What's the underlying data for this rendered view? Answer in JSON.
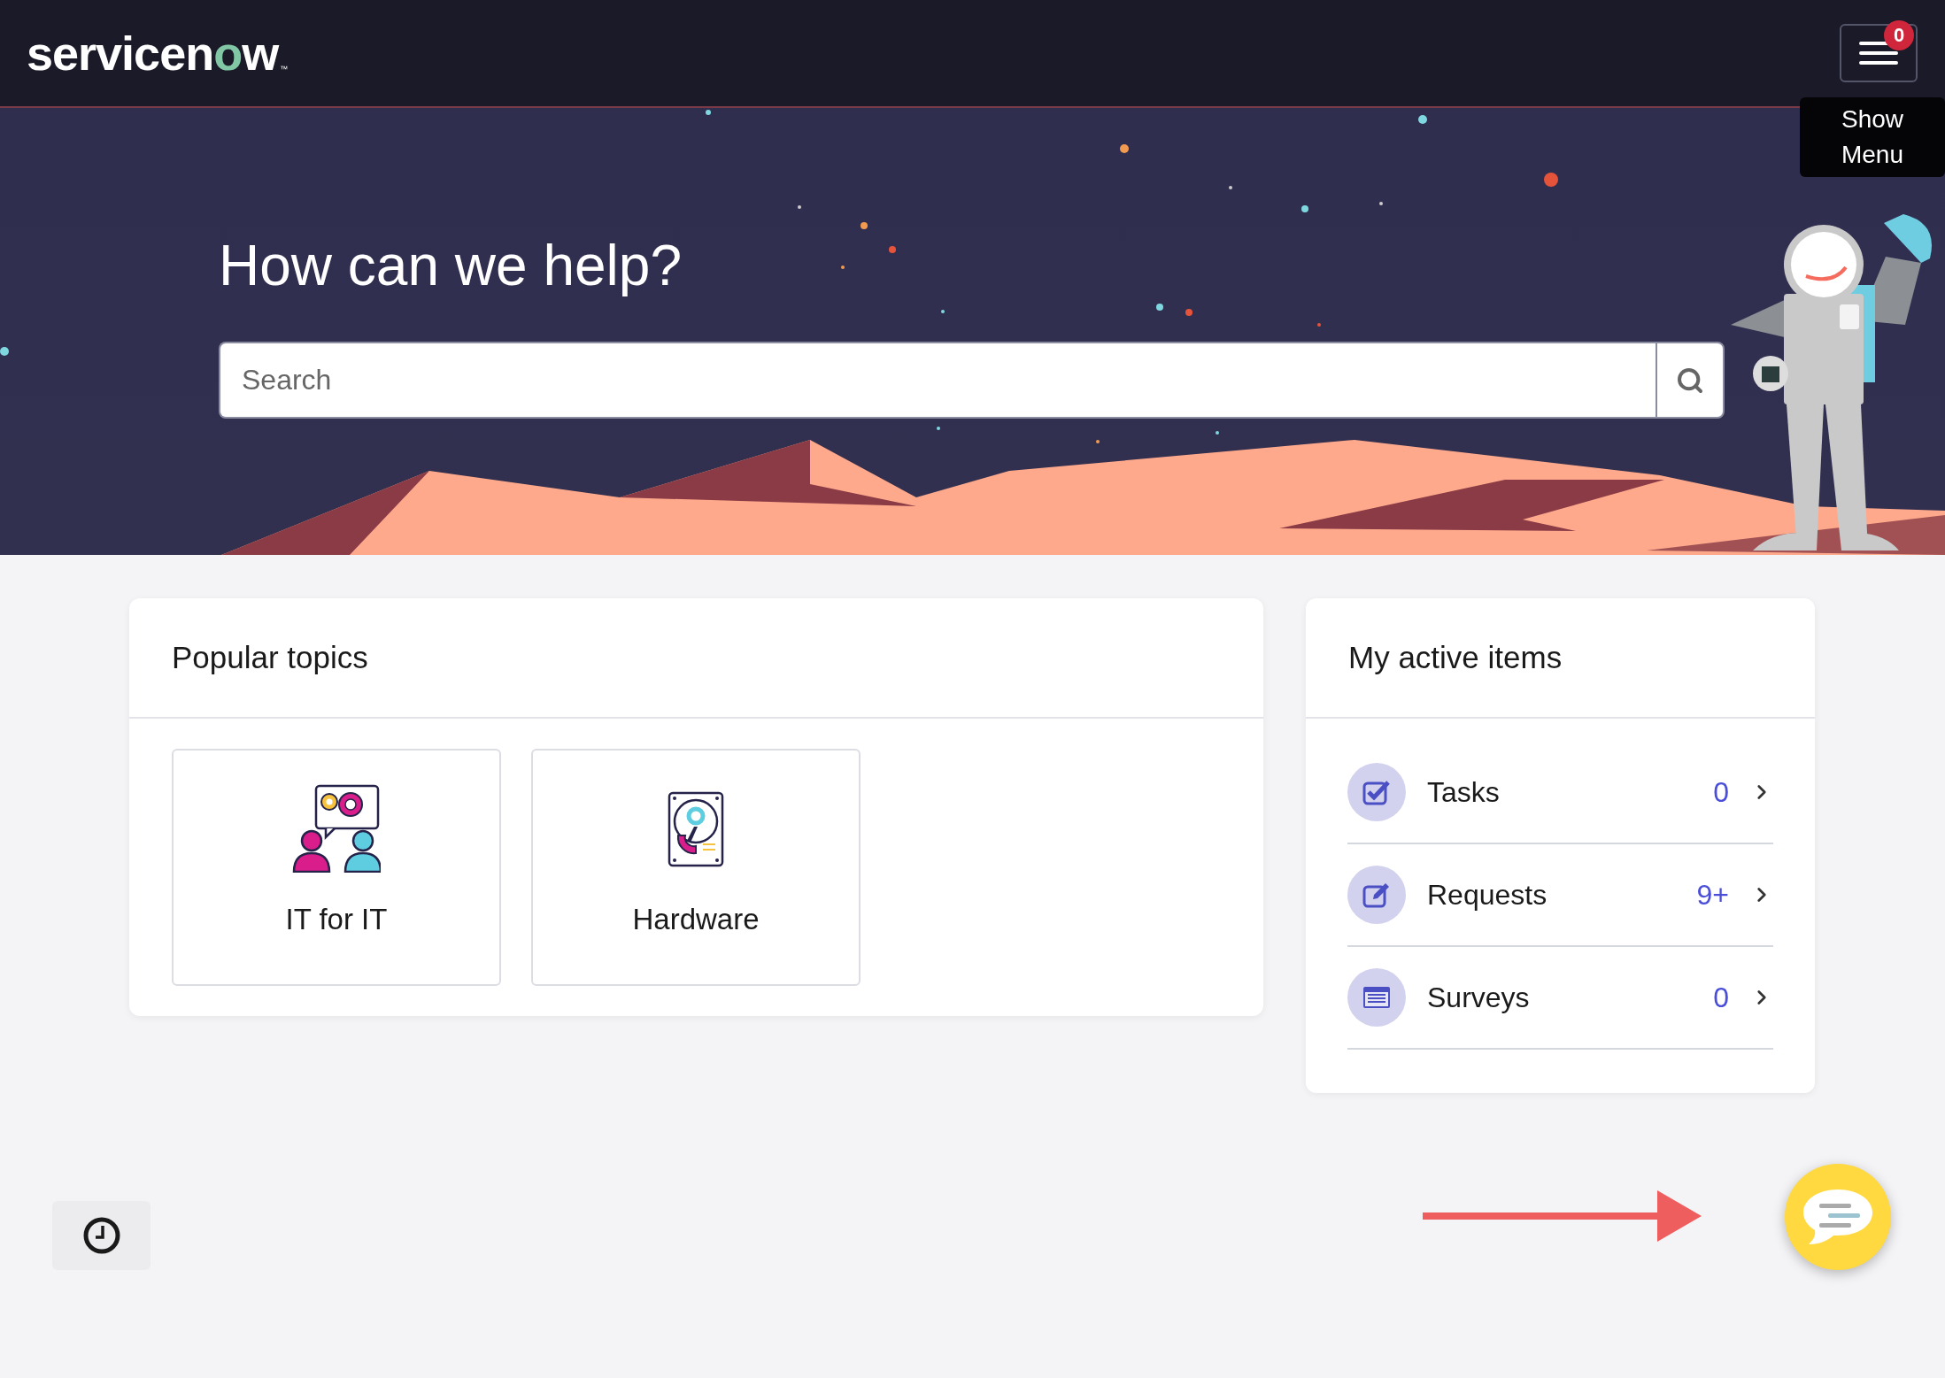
{
  "header": {
    "logo": "servicenow",
    "logo_mark": "™",
    "menu_badge": "0",
    "menu_tooltip": "Show Menu"
  },
  "hero": {
    "title": "How can we help?",
    "search": {
      "placeholder": "Search"
    }
  },
  "popular_topics": {
    "title": "Popular topics",
    "topics": [
      {
        "label": "IT for IT",
        "kind": "people"
      },
      {
        "label": "Hardware",
        "kind": "disk"
      }
    ]
  },
  "active_items": {
    "title": "My active items",
    "items": [
      {
        "label": "Tasks",
        "count": "0",
        "kind": "tasks"
      },
      {
        "label": "Requests",
        "count": "9+",
        "kind": "requests"
      },
      {
        "label": "Surveys",
        "count": "0",
        "kind": "surveys"
      }
    ]
  }
}
